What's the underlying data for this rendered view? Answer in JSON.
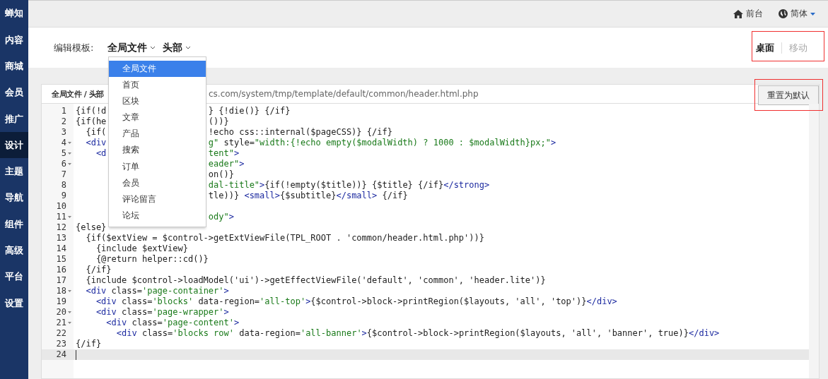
{
  "sidebar": {
    "items": [
      {
        "label": "蝉知",
        "kind": "logo",
        "selected": false
      },
      {
        "label": "内容",
        "kind": "menu",
        "selected": false
      },
      {
        "label": "商城",
        "kind": "menu",
        "selected": false
      },
      {
        "label": "会员",
        "kind": "menu",
        "selected": false
      },
      {
        "label": "推广",
        "kind": "menu",
        "selected": false
      },
      {
        "label": "设计",
        "kind": "menu",
        "selected": true
      },
      {
        "label": "主题",
        "kind": "menu",
        "selected": false
      },
      {
        "label": "导航",
        "kind": "menu",
        "selected": false
      },
      {
        "label": "组件",
        "kind": "menu",
        "selected": false
      },
      {
        "label": "高级",
        "kind": "menu",
        "selected": false
      },
      {
        "label": "平台",
        "kind": "menu",
        "selected": false
      },
      {
        "label": "设置",
        "kind": "menu",
        "selected": false
      }
    ]
  },
  "topbar": {
    "links": [
      {
        "label": "前台",
        "kind": "home"
      },
      {
        "label": "简体",
        "kind": "language"
      }
    ]
  },
  "editor_header": {
    "label": "编辑模板:",
    "selectors": [
      {
        "label": "全局文件",
        "menu_items": [
          {
            "label": "全局文件",
            "selected": true
          },
          {
            "label": "首页",
            "selected": false
          },
          {
            "label": "区块",
            "selected": false
          },
          {
            "label": "文章",
            "selected": false
          },
          {
            "label": "产品",
            "selected": false
          },
          {
            "label": "搜索",
            "selected": false
          },
          {
            "label": "订单",
            "selected": false
          },
          {
            "label": "会员",
            "selected": false
          },
          {
            "label": "评论留言",
            "selected": false
          },
          {
            "label": "论坛",
            "selected": false
          }
        ]
      },
      {
        "label": "头部"
      }
    ]
  },
  "view_tabs": [
    {
      "label": "桌面",
      "selected": true
    },
    {
      "label": "移动",
      "selected": false
    }
  ],
  "file_panel": {
    "breadcrumb": "全局文件 / 头部",
    "path": "cs.com/system/tmp/template/default/common/header.html.php",
    "reset_button": "重置为默认"
  },
  "code_editor": {
    "lines": [
      {
        "number": "1",
        "foldable": false,
        "active": false,
        "left": [
          {
            "kind": "plain",
            "text": "{if(!d"
          }
        ],
        "right": [
          {
            "kind": "plain",
            "text": "} {!die()} {/if}"
          }
        ]
      },
      {
        "number": "2",
        "foldable": false,
        "active": false,
        "left": [
          {
            "kind": "plain",
            "text": "{if(he"
          }
        ],
        "right": [
          {
            "kind": "plain",
            "text": "())}"
          }
        ]
      },
      {
        "number": "3",
        "foldable": false,
        "active": false,
        "left": [
          {
            "kind": "plain",
            "text": "  {if("
          }
        ],
        "right": [
          {
            "kind": "plain",
            "text": "!echo css::internal($pageCSS)} {/if}"
          }
        ]
      },
      {
        "number": "4",
        "foldable": true,
        "active": false,
        "left": [
          {
            "kind": "tag",
            "text": "  <div"
          }
        ],
        "right": [
          {
            "kind": "string",
            "text": "g\""
          },
          {
            "kind": "plain",
            "text": " style="
          },
          {
            "kind": "string",
            "text": "\"width:{!echo empty($modalWidth) ? 1000 : $modalWidth}px;\""
          },
          {
            "kind": "tag",
            "text": ">"
          }
        ]
      },
      {
        "number": "5",
        "foldable": true,
        "active": false,
        "left": [
          {
            "kind": "tag",
            "text": "    <d"
          }
        ],
        "right": [
          {
            "kind": "string",
            "text": "tent\""
          },
          {
            "kind": "tag",
            "text": ">"
          }
        ]
      },
      {
        "number": "6",
        "foldable": true,
        "active": false,
        "right": [
          {
            "kind": "string",
            "text": "eader\""
          },
          {
            "kind": "tag",
            "text": ">"
          }
        ]
      },
      {
        "number": "7",
        "foldable": false,
        "active": false,
        "right": [
          {
            "kind": "plain",
            "text": "on()}"
          }
        ]
      },
      {
        "number": "8",
        "foldable": false,
        "active": false,
        "right": [
          {
            "kind": "string",
            "text": "dal-title\""
          },
          {
            "kind": "tag",
            "text": ">"
          },
          {
            "kind": "plain",
            "text": "{if(!empty($title))} {$title} {/if}"
          },
          {
            "kind": "tag",
            "text": "</strong>"
          }
        ]
      },
      {
        "number": "9",
        "foldable": false,
        "active": false,
        "right": [
          {
            "kind": "plain",
            "text": "tle))} "
          },
          {
            "kind": "tag",
            "text": "<small>"
          },
          {
            "kind": "plain",
            "text": "{$subtitle}"
          },
          {
            "kind": "tag",
            "text": "</small>"
          },
          {
            "kind": "plain",
            "text": " {/if}"
          }
        ]
      },
      {
        "number": "10",
        "foldable": false,
        "active": false
      },
      {
        "number": "11",
        "foldable": true,
        "active": false,
        "right": [
          {
            "kind": "string",
            "text": "ody\""
          },
          {
            "kind": "tag",
            "text": ">"
          }
        ]
      },
      {
        "number": "12",
        "foldable": false,
        "active": false,
        "left": [
          {
            "kind": "plain",
            "text": "{else}"
          }
        ]
      },
      {
        "number": "13",
        "foldable": false,
        "active": false,
        "left": [
          {
            "kind": "plain",
            "text": "  {if($extView = $control->getExtViewFile(TPL_ROOT . 'common/header.html.php'))}"
          }
        ]
      },
      {
        "number": "14",
        "foldable": false,
        "active": false,
        "left": [
          {
            "kind": "plain",
            "text": "    {include $extView}"
          }
        ]
      },
      {
        "number": "15",
        "foldable": false,
        "active": false,
        "left": [
          {
            "kind": "plain",
            "text": "    {@return helper::cd()}"
          }
        ]
      },
      {
        "number": "16",
        "foldable": false,
        "active": false,
        "left": [
          {
            "kind": "plain",
            "text": "  {/if}"
          }
        ]
      },
      {
        "number": "17",
        "foldable": false,
        "active": false,
        "left": [
          {
            "kind": "plain",
            "text": "  {include $control->loadModel('ui')->getEffectViewFile('default', 'common', 'header.lite')}"
          }
        ]
      },
      {
        "number": "18",
        "foldable": true,
        "active": false,
        "left": [
          {
            "kind": "tag",
            "text": "  <div"
          },
          {
            "kind": "plain",
            "text": " class="
          },
          {
            "kind": "string",
            "text": "'page-container'"
          },
          {
            "kind": "tag",
            "text": ">"
          }
        ]
      },
      {
        "number": "19",
        "foldable": false,
        "active": false,
        "left": [
          {
            "kind": "tag",
            "text": "    <div"
          },
          {
            "kind": "plain",
            "text": " class="
          },
          {
            "kind": "string",
            "text": "'blocks'"
          },
          {
            "kind": "plain",
            "text": " data-region="
          },
          {
            "kind": "string",
            "text": "'all-top'"
          },
          {
            "kind": "tag",
            "text": ">"
          },
          {
            "kind": "plain",
            "text": "{$control->block->printRegion($layouts, 'all', 'top')}"
          },
          {
            "kind": "tag",
            "text": "</div>"
          }
        ]
      },
      {
        "number": "20",
        "foldable": true,
        "active": false,
        "left": [
          {
            "kind": "tag",
            "text": "    <div"
          },
          {
            "kind": "plain",
            "text": " class="
          },
          {
            "kind": "string",
            "text": "'page-wrapper'"
          },
          {
            "kind": "tag",
            "text": ">"
          }
        ]
      },
      {
        "number": "21",
        "foldable": true,
        "active": false,
        "left": [
          {
            "kind": "tag",
            "text": "      <div"
          },
          {
            "kind": "plain",
            "text": " class="
          },
          {
            "kind": "string",
            "text": "'page-content'"
          },
          {
            "kind": "tag",
            "text": ">"
          }
        ]
      },
      {
        "number": "22",
        "foldable": false,
        "active": false,
        "left": [
          {
            "kind": "tag",
            "text": "        <div"
          },
          {
            "kind": "plain",
            "text": " class="
          },
          {
            "kind": "string",
            "text": "'blocks row'"
          },
          {
            "kind": "plain",
            "text": " data-region="
          },
          {
            "kind": "string",
            "text": "'all-banner'"
          },
          {
            "kind": "tag",
            "text": ">"
          },
          {
            "kind": "plain",
            "text": "{$control->block->printRegion($layouts, 'all', 'banner', true)}"
          },
          {
            "kind": "tag",
            "text": "</div>"
          }
        ]
      },
      {
        "number": "23",
        "foldable": false,
        "active": false,
        "left": [
          {
            "kind": "plain",
            "text": "{/if}"
          }
        ]
      },
      {
        "number": "24",
        "foldable": false,
        "active": true
      }
    ]
  }
}
